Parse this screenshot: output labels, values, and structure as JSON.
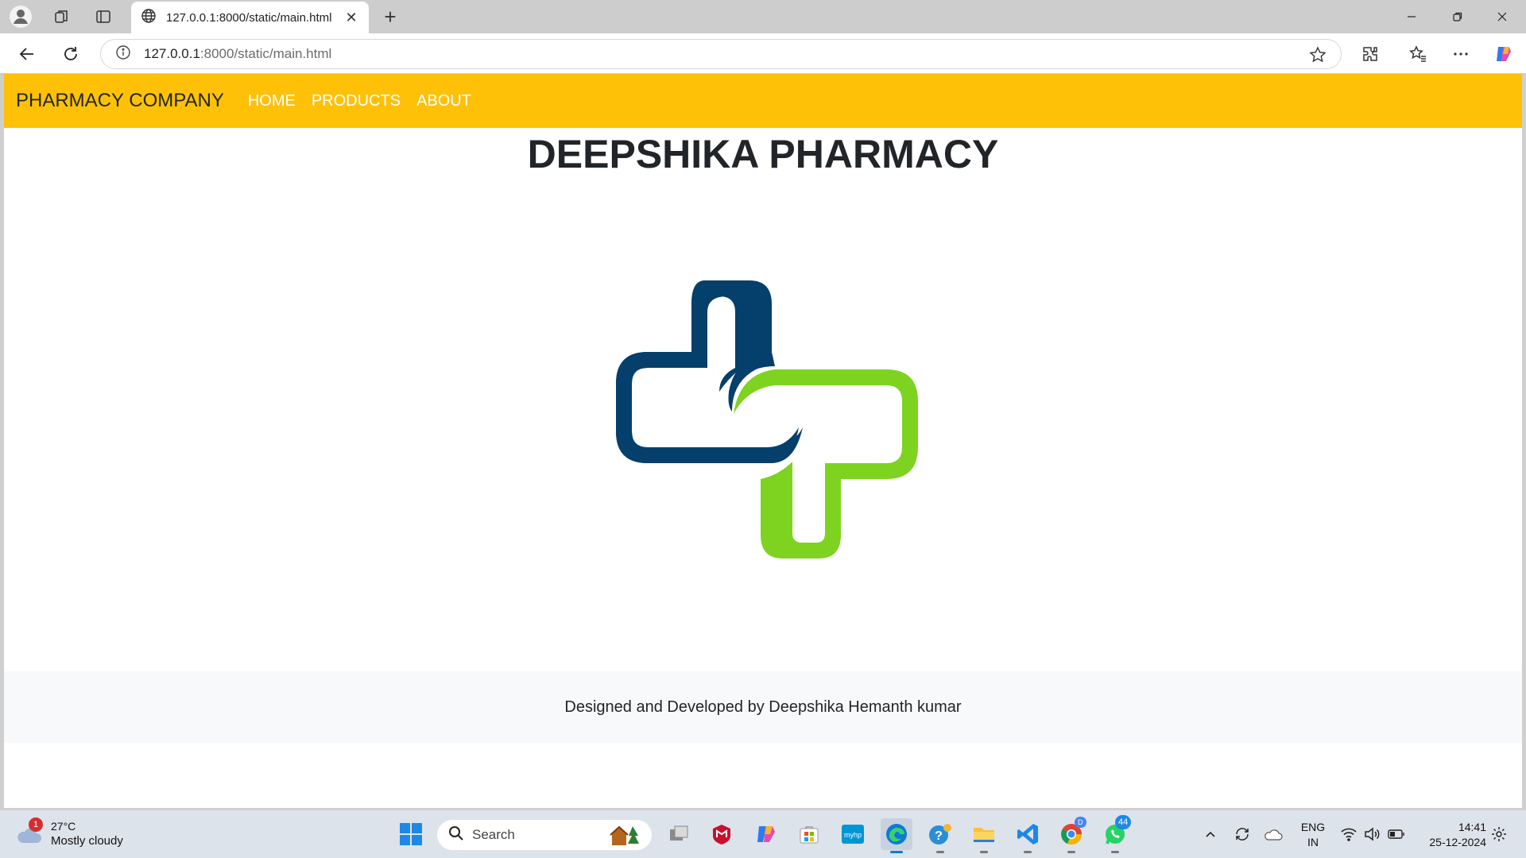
{
  "browser": {
    "tab_title": "127.0.0.1:8000/static/main.html",
    "url_host": "127.0.0.1",
    "url_rest": ":8000/static/main.html"
  },
  "page": {
    "brand": "PHARMACY COMPANY",
    "nav": [
      "HOME",
      "PRODUCTS",
      "ABOUT"
    ],
    "title": "DEEPSHIKA PHARMACY",
    "footer": "Designed and Developed by Deepshika Hemanth kumar",
    "colors": {
      "navbar": "#ffc107",
      "logo_blue": "#053f6b",
      "logo_green": "#7ed321",
      "footer_bg": "#f8f9fa"
    }
  },
  "taskbar": {
    "weather_badge": "1",
    "temperature": "27°C",
    "condition": "Mostly cloudy",
    "search_placeholder": "Search",
    "whatsapp_badge": "44",
    "chrome_badge": "D",
    "lang_top": "ENG",
    "lang_bottom": "IN",
    "time": "14:41",
    "date": "25-12-2024"
  }
}
